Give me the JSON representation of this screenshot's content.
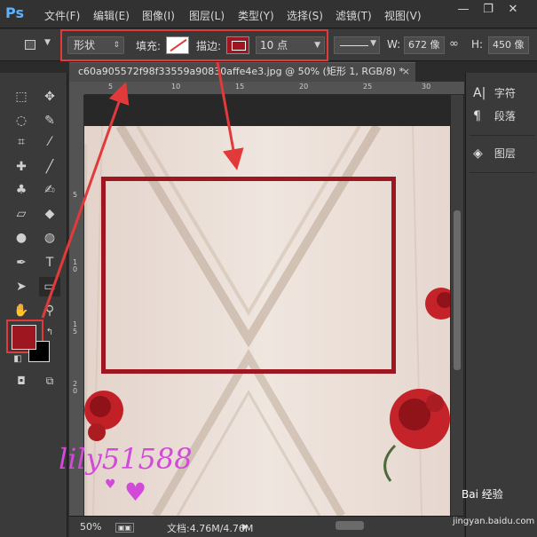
{
  "app": {
    "logo": "Ps"
  },
  "menu": [
    "文件(F)",
    "编辑(E)",
    "图像(I)",
    "图层(L)",
    "类型(Y)",
    "选择(S)",
    "滤镜(T)",
    "视图(V)"
  ],
  "window_controls": {
    "minimize": "—",
    "restore": "❐",
    "close": "✕"
  },
  "options_bar": {
    "mode": "形状",
    "fill_label": "填充:",
    "stroke_label": "描边:",
    "stroke_size": "10 点",
    "width_label": "W:",
    "width_value": "672 像",
    "height_label": "H:",
    "height_value": "450 像",
    "stroke_color": "#9d1620"
  },
  "document": {
    "tab_title": "c60a905572f98f33559a90830affe4e3.jpg @ 50% (矩形 1, RGB/8) *",
    "close": "×"
  },
  "ruler_top_labels": [
    "5",
    "10",
    "15",
    "20",
    "25",
    "30"
  ],
  "ruler_left_labels": [
    "5",
    "1\n0",
    "1\n5",
    "2\n0"
  ],
  "toolbox": {
    "foreground_color": "#9d1620",
    "background_color": "#000000"
  },
  "status": {
    "zoom": "50%",
    "doc_info": "文档:4.76M/4.76M"
  },
  "right_panel": {
    "items": [
      {
        "icon": "character-icon",
        "glyph": "A|",
        "label": "字符"
      },
      {
        "icon": "paragraph-icon",
        "glyph": "¶",
        "label": "段落"
      },
      {
        "icon": "layers-icon",
        "glyph": "◈",
        "label": "图层"
      }
    ]
  },
  "canvas": {
    "watermark_text": "lily51588",
    "rect_stroke_color": "#9d1620"
  },
  "overlay": {
    "baidu_brand": "Bai 经验",
    "baidu_url": "jingyan.baidu.com"
  }
}
